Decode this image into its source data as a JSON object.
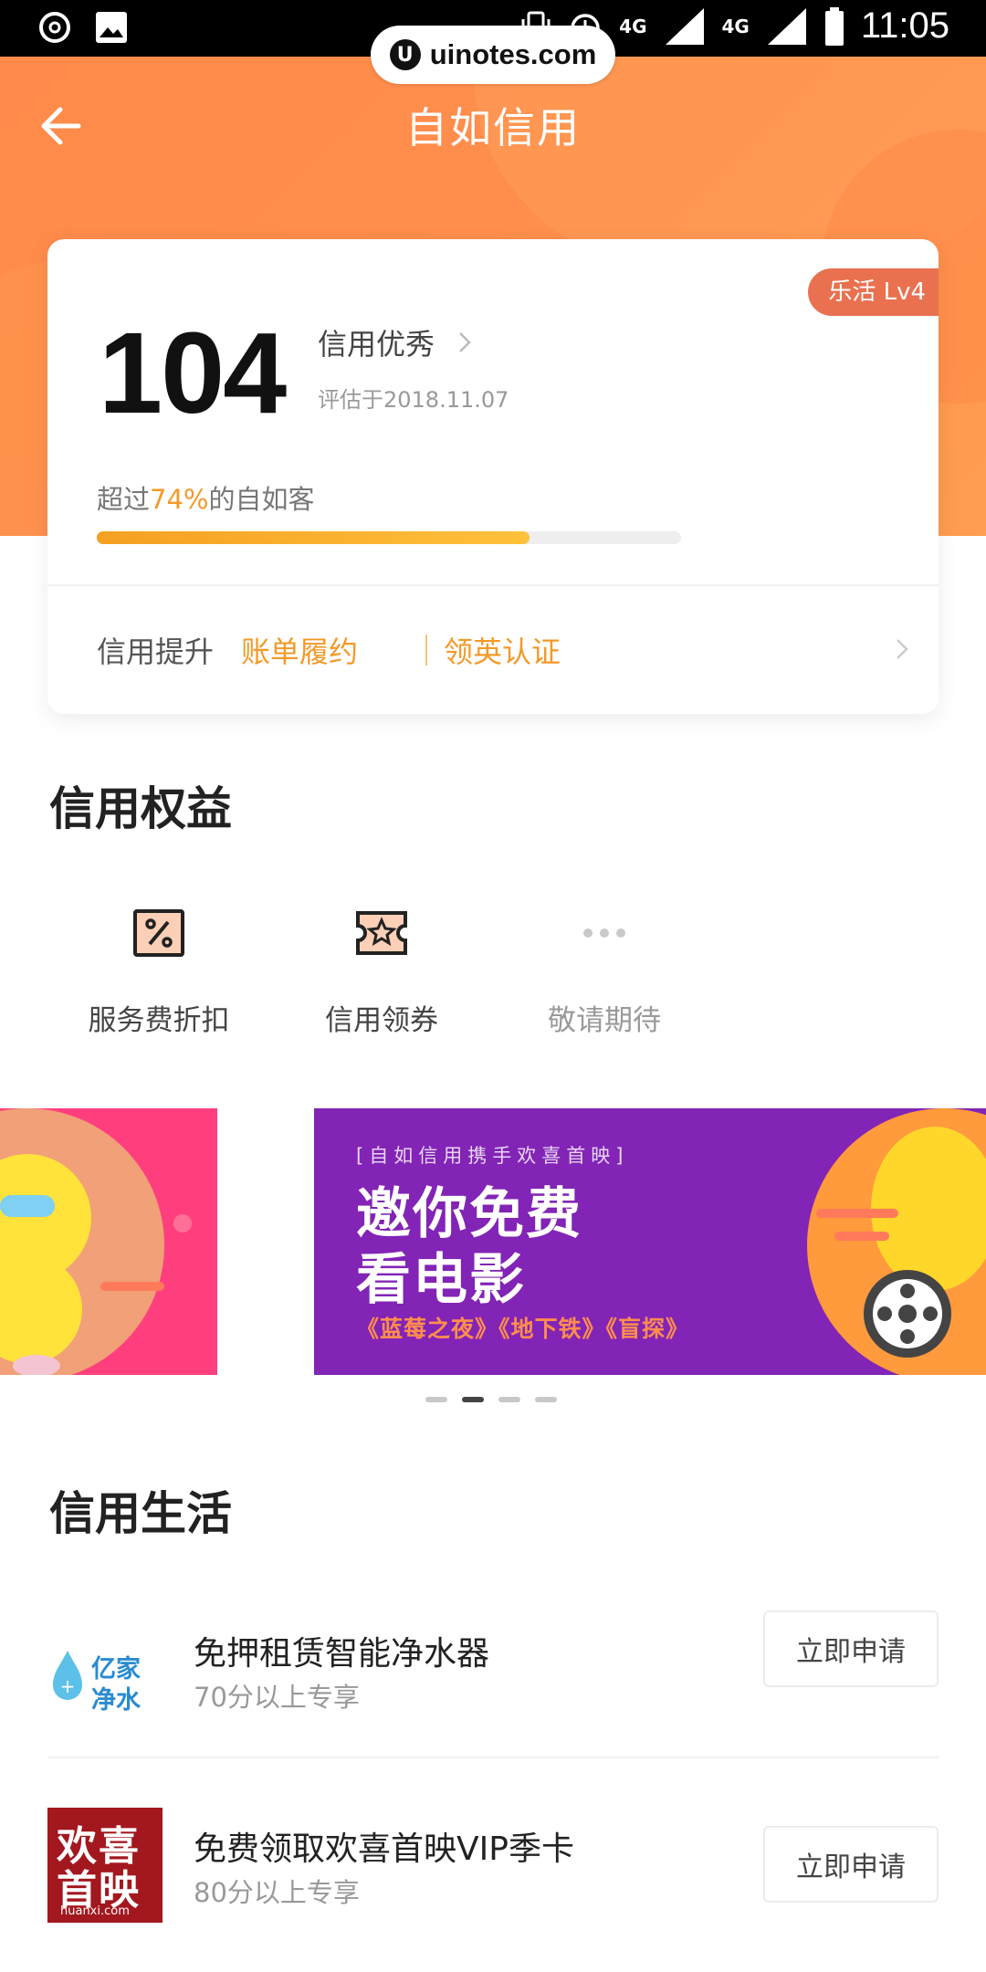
{
  "status_bar": {
    "time": "11:05",
    "network_1": "4G",
    "network_2": "4G"
  },
  "watermark": {
    "logo": "U",
    "text": "uinotes.com"
  },
  "header": {
    "title": "自如信用"
  },
  "score_card": {
    "level_badge": "乐活 Lv4",
    "score": "104",
    "level_text": "信用优秀",
    "evaluated_date": "评估于2018.11.07",
    "surpass_prefix": "超过",
    "surpass_percent": "74%",
    "surpass_suffix": "的自如客",
    "progress": 0.74,
    "boost_label": "信用提升",
    "boost_links": [
      "账单履约",
      "领英认证"
    ]
  },
  "benefits": {
    "title": "信用权益",
    "items": [
      {
        "label": "服务费折扣",
        "icon": "discount-icon"
      },
      {
        "label": "信用领券",
        "icon": "coupon-icon"
      },
      {
        "label": "敬请期待",
        "icon": "more-dots-icon"
      }
    ]
  },
  "banner": {
    "subtitle": "[自如信用携手欢喜首映]",
    "title_line1": "邀你免费",
    "title_line2": "看电影",
    "movies": "《蓝莓之夜》《地下铁》《盲探》",
    "page_count": 4,
    "active_index": 1
  },
  "credit_life": {
    "title": "信用生活",
    "items": [
      {
        "logo_text_1": "亿家",
        "logo_text_2": "净水",
        "title": "免押租赁智能净水器",
        "subtitle": "70分以上专享",
        "button": "立即申请"
      },
      {
        "logo_text_1": "欢喜",
        "logo_text_2": "首映",
        "logo_domain": "huanxi.com",
        "title": "免费领取欢喜首映VIP季卡",
        "subtitle": "80分以上专享",
        "button": "立即申请"
      }
    ]
  },
  "colors": {
    "accent": "#f39a29",
    "header": "#ff8e4c",
    "badge": "#e9714f",
    "banner_purple": "#8224b5",
    "banner_pink": "#ff3f7d"
  }
}
